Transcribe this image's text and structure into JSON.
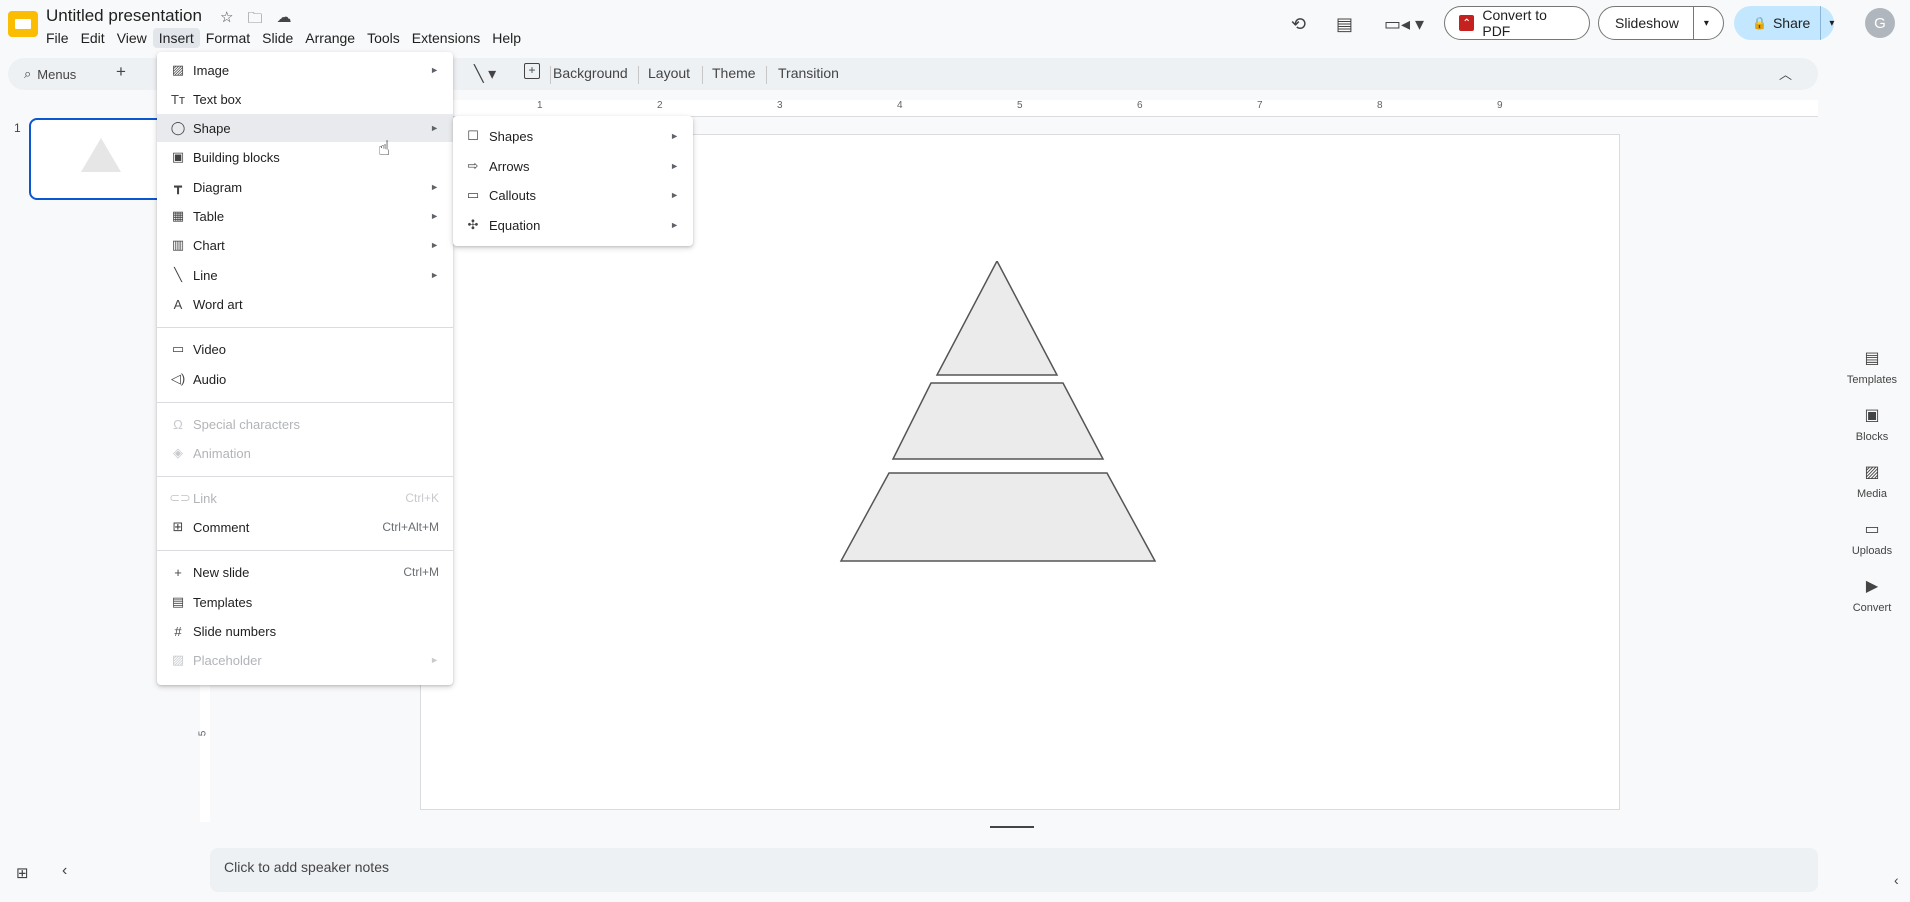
{
  "app": {
    "title": "Untitled presentation",
    "menus": [
      "File",
      "Edit",
      "View",
      "Insert",
      "Format",
      "Slide",
      "Arrange",
      "Tools",
      "Extensions",
      "Help"
    ],
    "active_menu": "Insert"
  },
  "header": {
    "convert_pdf": "Convert to PDF",
    "slideshow": "Slideshow",
    "share": "Share",
    "avatar_letter": "G"
  },
  "toolbar": {
    "search": "Menus",
    "background": "Background",
    "layout": "Layout",
    "theme": "Theme",
    "transition": "Transition"
  },
  "ruler": {
    "marks": [
      "1",
      "2",
      "3",
      "4",
      "5",
      "6",
      "7",
      "8",
      "9"
    ],
    "vertical_mark": "5"
  },
  "filmstrip": {
    "slide_number": "1"
  },
  "insert_menu": {
    "items": [
      {
        "label": "Image",
        "icon": "image-icon",
        "submenu": true
      },
      {
        "label": "Text box",
        "icon": "text-box-icon"
      },
      {
        "label": "Shape",
        "icon": "shape-icon",
        "submenu": true,
        "hover": true
      },
      {
        "label": "Building blocks",
        "icon": "building-blocks-icon"
      },
      {
        "label": "Diagram",
        "icon": "diagram-icon",
        "submenu": true
      },
      {
        "label": "Table",
        "icon": "table-icon",
        "submenu": true
      },
      {
        "label": "Chart",
        "icon": "chart-icon",
        "submenu": true
      },
      {
        "label": "Line",
        "icon": "line-icon",
        "submenu": true
      },
      {
        "label": "Word art",
        "icon": "word-art-icon"
      },
      {
        "label": "Video",
        "icon": "video-icon"
      },
      {
        "label": "Audio",
        "icon": "audio-icon"
      },
      {
        "label": "Special characters",
        "icon": "omega-icon",
        "disabled": true
      },
      {
        "label": "Animation",
        "icon": "animation-icon",
        "disabled": true
      },
      {
        "label": "Link",
        "icon": "link-icon",
        "disabled": true,
        "shortcut": "Ctrl+K"
      },
      {
        "label": "Comment",
        "icon": "comment-icon",
        "shortcut": "Ctrl+Alt+M"
      },
      {
        "label": "New slide",
        "icon": "plus-icon",
        "shortcut": "Ctrl+M"
      },
      {
        "label": "Templates",
        "icon": "templates-icon"
      },
      {
        "label": "Slide numbers",
        "icon": "hash-icon"
      },
      {
        "label": "Placeholder",
        "icon": "placeholder-icon",
        "disabled": true,
        "submenu": true
      }
    ]
  },
  "shape_submenu": {
    "items": [
      {
        "label": "Shapes",
        "icon": "square-icon"
      },
      {
        "label": "Arrows",
        "icon": "arrow-icon"
      },
      {
        "label": "Callouts",
        "icon": "callout-icon"
      },
      {
        "label": "Equation",
        "icon": "equation-icon"
      }
    ]
  },
  "side_panel": {
    "items": [
      "Templates",
      "Blocks",
      "Media",
      "Uploads",
      "Convert"
    ]
  },
  "notes": {
    "placeholder": "Click to add speaker notes"
  }
}
